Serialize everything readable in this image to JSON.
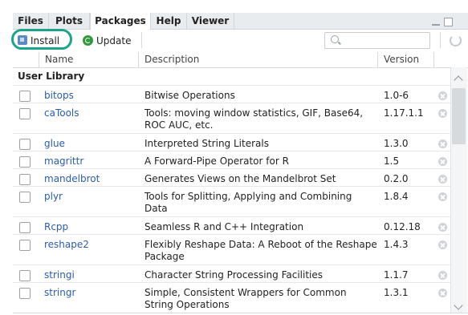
{
  "tabs": [
    {
      "label": "Files"
    },
    {
      "label": "Plots"
    },
    {
      "label": "Packages"
    },
    {
      "label": "Help"
    },
    {
      "label": "Viewer"
    }
  ],
  "active_tab": "Packages",
  "toolbar": {
    "install_label": "Install",
    "update_label": "Update",
    "search_placeholder": ""
  },
  "columns": {
    "name": "Name",
    "description": "Description",
    "version": "Version"
  },
  "library_label": "User Library",
  "packages": [
    {
      "name": "bitops",
      "description": "Bitwise Operations",
      "version": "1.0-6"
    },
    {
      "name": "caTools",
      "description": "Tools: moving window statistics, GIF, Base64, ROC AUC, etc.",
      "version": "1.17.1.1"
    },
    {
      "name": "glue",
      "description": "Interpreted String Literals",
      "version": "1.3.0"
    },
    {
      "name": "magrittr",
      "description": "A Forward-Pipe Operator for R",
      "version": "1.5"
    },
    {
      "name": "mandelbrot",
      "description": "Generates Views on the Mandelbrot Set",
      "version": "0.2.0"
    },
    {
      "name": "plyr",
      "description": "Tools for Splitting, Applying and Combining Data",
      "version": "1.8.4"
    },
    {
      "name": "Rcpp",
      "description": "Seamless R and C++ Integration",
      "version": "0.12.18"
    },
    {
      "name": "reshape2",
      "description": "Flexibly Reshape Data: A Reboot of the Reshape Package",
      "version": "1.4.3"
    },
    {
      "name": "stringi",
      "description": "Character String Processing Facilities",
      "version": "1.1.7"
    },
    {
      "name": "stringr",
      "description": "Simple, Consistent Wrappers for Common String Operations",
      "version": "1.3.1"
    }
  ],
  "colors": {
    "highlight_ring": "#1aa58a",
    "package_link": "#2a5db0",
    "update_icon": "#2f9a3a"
  }
}
